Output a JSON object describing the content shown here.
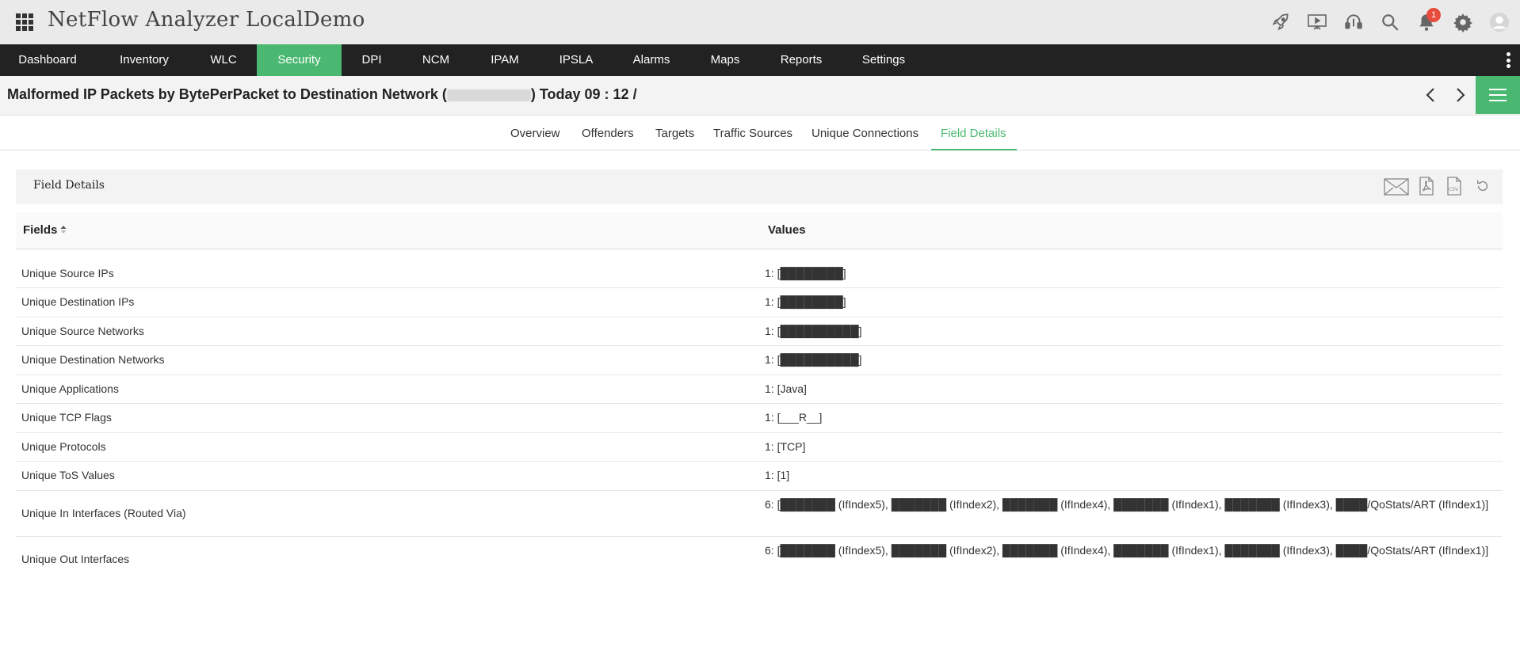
{
  "app": {
    "title": "NetFlow Analyzer LocalDemo",
    "notification_count": "1"
  },
  "topbar_icons": [
    "rocket-icon",
    "presentation-icon",
    "headset-icon",
    "search-icon",
    "bell-icon",
    "gear-icon",
    "user-avatar-icon"
  ],
  "nav": {
    "items": [
      {
        "label": "Dashboard"
      },
      {
        "label": "Inventory"
      },
      {
        "label": "WLC"
      },
      {
        "label": "Security"
      },
      {
        "label": "DPI"
      },
      {
        "label": "NCM"
      },
      {
        "label": "IPAM"
      },
      {
        "label": "IPSLA"
      },
      {
        "label": "Alarms"
      },
      {
        "label": "Maps"
      },
      {
        "label": "Reports"
      },
      {
        "label": "Settings"
      }
    ],
    "active": "Security"
  },
  "page": {
    "title_prefix": "Malformed IP Packets by BytePerPacket to Destination Network (",
    "title_suffix": ") Today 09 : 12 /"
  },
  "tabs": {
    "items": [
      {
        "label": "Overview"
      },
      {
        "label": "Offenders"
      },
      {
        "label": "Targets"
      },
      {
        "label": "Traffic Sources"
      },
      {
        "label": "Unique Connections"
      },
      {
        "label": "Field Details"
      }
    ],
    "active": "Field Details"
  },
  "panel": {
    "title": "Field Details",
    "actions": [
      "email-icon",
      "pdf-icon",
      "csv-icon",
      "refresh-icon"
    ],
    "csv_label": "CSV"
  },
  "table": {
    "columns": {
      "fields": "Fields",
      "values": "Values"
    },
    "rows": [
      {
        "field": "Unique Source IPs",
        "value": "1: [████████]"
      },
      {
        "field": "Unique Destination IPs",
        "value": "1: [████████]"
      },
      {
        "field": "Unique Source Networks",
        "value": "1: [██████████]"
      },
      {
        "field": "Unique Destination Networks",
        "value": "1: [██████████]"
      },
      {
        "field": "Unique Applications",
        "value": "1: [Java]"
      },
      {
        "field": "Unique TCP Flags",
        "value": "1: [___R__]"
      },
      {
        "field": "Unique Protocols",
        "value": "1: [TCP]"
      },
      {
        "field": "Unique ToS Values",
        "value": "1: [1]"
      },
      {
        "field": "Unique In Interfaces (Routed Via)",
        "value": "6: [███████ (IfIndex5), ███████ (IfIndex2), ███████ (IfIndex4), ███████ (IfIndex1), ███████ (IfIndex3), ████/QoStats/ART (IfIndex1)]"
      },
      {
        "field": "Unique Out Interfaces",
        "value": "6: [███████ (IfIndex5), ███████ (IfIndex2), ███████ (IfIndex4), ███████ (IfIndex1), ███████ (IfIndex3), ████/QoStats/ART (IfIndex1)]"
      }
    ]
  },
  "colors": {
    "accent": "#4ab870",
    "nav_bg": "#222222",
    "header_bg": "#eaeaea",
    "badge": "#e74c3c"
  }
}
